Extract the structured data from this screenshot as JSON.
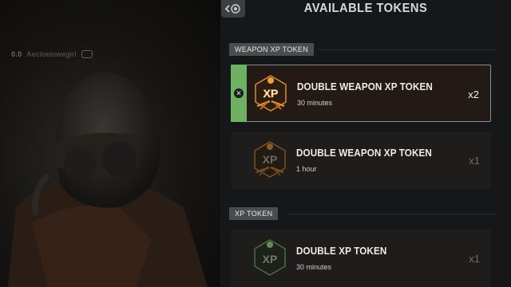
{
  "header": {
    "title": "AVAILABLE TOKENS"
  },
  "player": {
    "rank": "0.0",
    "name": "Aecioelowegirl"
  },
  "sections": [
    {
      "label": "WEAPON XP TOKEN",
      "tokens": [
        {
          "name": "DOUBLE WEAPON XP TOKEN",
          "duration": "30 minutes",
          "quantity": "x2",
          "selected": true,
          "icon": "weapon-xp-token-icon"
        },
        {
          "name": "DOUBLE WEAPON XP TOKEN",
          "duration": "1 hour",
          "quantity": "x1",
          "selected": false,
          "icon": "weapon-xp-token-icon"
        }
      ]
    },
    {
      "label": "XP TOKEN",
      "tokens": [
        {
          "name": "DOUBLE XP TOKEN",
          "duration": "30 minutes",
          "quantity": "x1",
          "selected": false,
          "icon": "xp-token-icon"
        }
      ]
    }
  ],
  "colors": {
    "selected_bar": "#6db162",
    "token_orange": "#e08a2c",
    "token_green": "#7fa36a"
  }
}
